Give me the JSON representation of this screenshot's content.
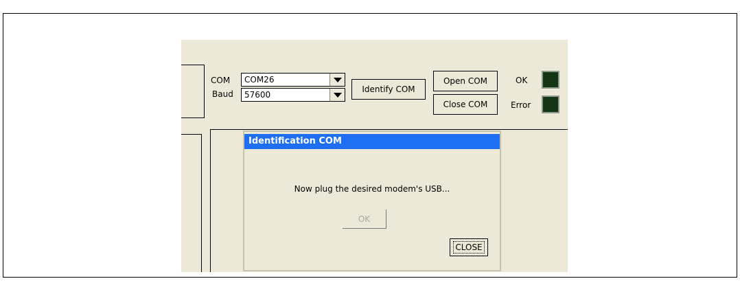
{
  "connection": {
    "com_label": "COM",
    "com_value": "COM26",
    "baud_label": "Baud",
    "baud_value": "57600",
    "identify_label": "Identify COM",
    "open_label": "Open COM",
    "close_label": "Close COM",
    "ok_label": "OK",
    "error_label": "Error"
  },
  "dialog": {
    "title": "Identification COM",
    "message": "Now plug the desired modem's USB...",
    "ok_label": "OK",
    "close_label": "CLOSE"
  },
  "colors": {
    "titlebar": "#1d6ef0",
    "led_off": "#123712",
    "window_bg": "#ece9d8"
  }
}
